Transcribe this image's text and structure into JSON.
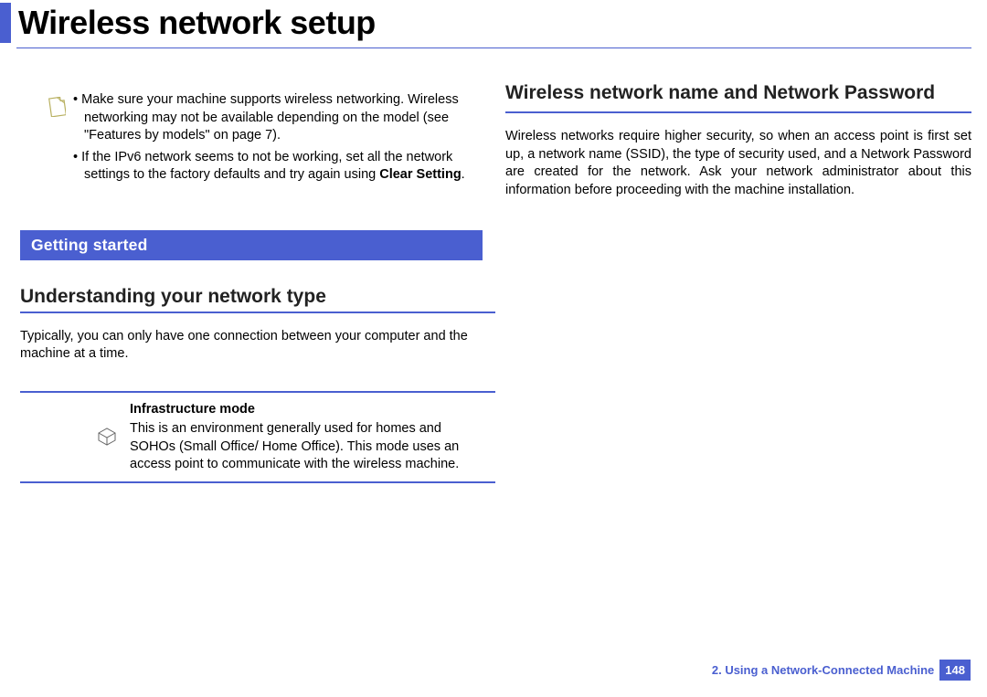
{
  "header": {
    "title": "Wireless network setup"
  },
  "note": {
    "items": [
      "Make sure your machine supports wireless networking. Wireless networking may not be available depending on the model (see \"Features by models\" on page 7).",
      "If the IPv6 network seems to not be working, set all the network settings to the factory defaults and try again using "
    ],
    "clear_setting": "Clear Setting",
    "period": "."
  },
  "left": {
    "banner": "Getting started",
    "sub_heading": "Understanding your network type",
    "body": "Typically, you can only have one connection between your computer and the machine at a time.",
    "def_title": "Infrastructure mode",
    "def_text": "This is an environment generally used for homes and SOHOs (Small Office/ Home Office). This mode uses an access point to communicate with the wireless machine."
  },
  "right": {
    "heading": "Wireless network name and Network Password",
    "body": "Wireless networks require higher security, so when an access point is first set up, a network name (SSID), the type of security used, and a Network Password are created for the network. Ask your network administrator about this information before proceeding with the machine installation."
  },
  "footer": {
    "chapter": "2.  Using a Network-Connected Machine",
    "page": "148"
  }
}
